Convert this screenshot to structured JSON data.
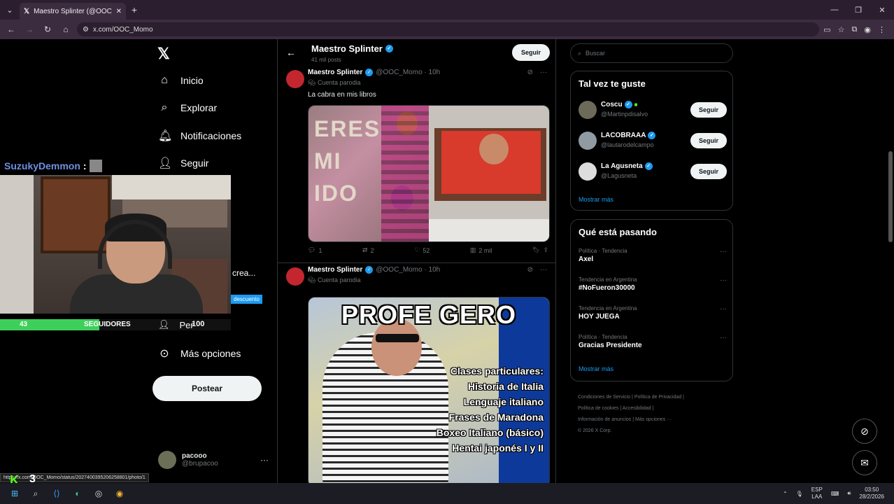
{
  "browser": {
    "tab_title": "Maestro Splinter (@OOC_Mo",
    "tab_icon": "x-logo",
    "url": "x.com/OOC_Momo",
    "status_url": "https://x.com/OOC_Momo/status/2027400395206258801/photo/1"
  },
  "nav": {
    "items": [
      {
        "label": "Inicio",
        "icon": "home-icon"
      },
      {
        "label": "Explorar",
        "icon": "search-icon"
      },
      {
        "label": "Notificaciones",
        "icon": "bell-icon"
      },
      {
        "label": "Seguir",
        "icon": "add-user-icon"
      }
    ],
    "perfil": "Per",
    "more": "Más opciones",
    "post_button": "Postear",
    "account": {
      "name": "pacooo",
      "handle": "@brupacoo"
    }
  },
  "stream": {
    "chat_user": "SuzukyDemmon",
    "chat_sep": ":",
    "crea_text": "crea...",
    "descuento": "descuento",
    "goal_current": "43",
    "goal_label": "SEGUIDORES",
    "goal_target": "100",
    "goal_fraction": 0.43,
    "kick_number": "3"
  },
  "profile": {
    "name": "Maestro Splinter",
    "posts": "41 mil posts",
    "follow": "Seguir"
  },
  "tweets": [
    {
      "name": "Maestro Splinter",
      "handle": "@OOC_Momo · 10h",
      "parody": "Cuenta parodia",
      "text": "La cabra en mis libros",
      "replies": "1",
      "reposts": "2",
      "likes": "52",
      "views": "2 mil",
      "media_letters": "ERES\nMI\nIDO"
    },
    {
      "name": "Maestro Splinter",
      "handle": "@OOC_Momo · 10h",
      "parody": "Cuenta parodia",
      "meme_title": "PROFE GERO",
      "meme_lines": [
        "Clases particulares:",
        "Historia de Italia",
        "Lenguaje italiano",
        "Frases de Maradona",
        "Boxeo Italiano (básico)",
        "Hentai japonés I y II"
      ]
    }
  ],
  "right": {
    "search_placeholder": "Buscar",
    "who_title": "Tal vez te guste",
    "who": [
      {
        "name": "Coscu",
        "handle": "@Martinpdisalvo",
        "button": "Seguir"
      },
      {
        "name": "LACOBRAAA",
        "handle": "@lautarodelcampo",
        "button": "Seguir"
      },
      {
        "name": "La Agusneta",
        "handle": "@Lagusneta",
        "button": "Seguir"
      }
    ],
    "show_more": "Mostrar más",
    "trends_title": "Qué está pasando",
    "trends": [
      {
        "context": "Política · Tendencia",
        "topic": "Axel"
      },
      {
        "context": "Tendencia en Argentina",
        "topic": "#NoFueron30000"
      },
      {
        "context": "Tendencia en Argentina",
        "topic": "HOY JUEGA"
      },
      {
        "context": "Política · Tendencia",
        "topic": "Gracias Presidente"
      }
    ],
    "trends_more": "Mostrar más",
    "footer": [
      "Condiciones de Servicio",
      "Política de Privacidad",
      "Política de cookies",
      "Accesibilidad",
      "Información de anuncios",
      "Más opciones ···",
      "© 2026 X Corp."
    ]
  },
  "taskbar": {
    "lang_top": "ESP",
    "lang_bottom": "LAA",
    "time": "03:50",
    "date": "28/2/2026"
  }
}
